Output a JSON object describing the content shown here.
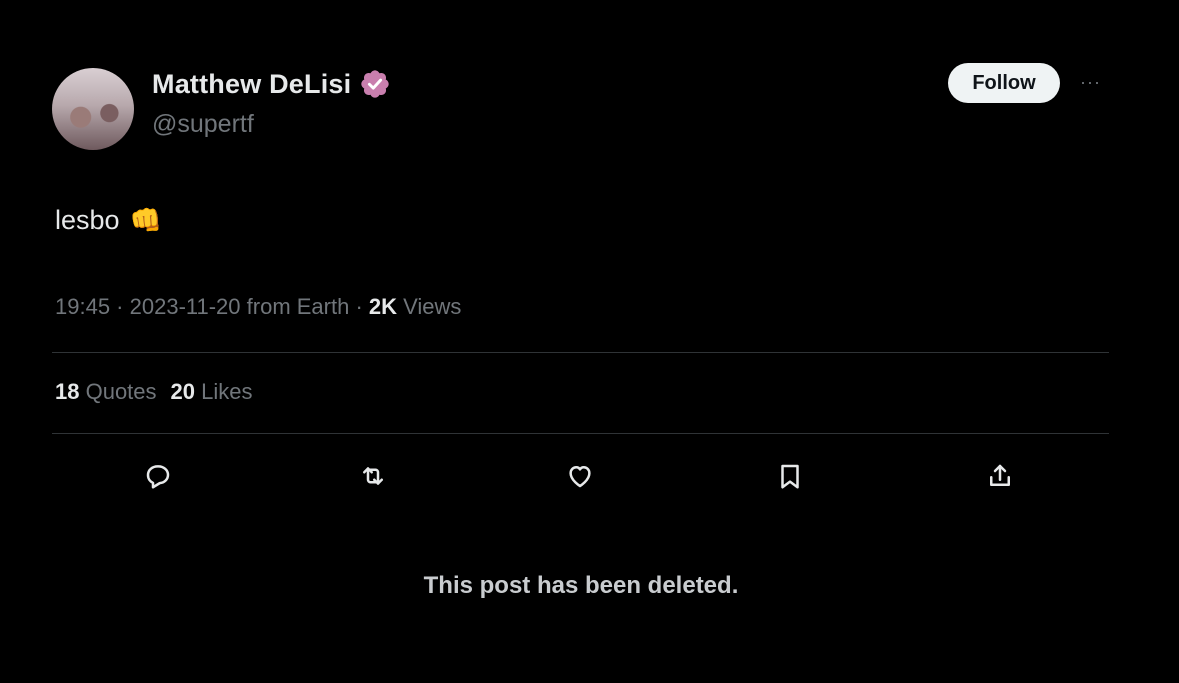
{
  "author": {
    "display_name": "Matthew DeLisi",
    "handle": "@supertf",
    "verified_icon": "verified-badge-icon",
    "verified_color": "#c97fae"
  },
  "header": {
    "follow_label": "Follow",
    "more_label": "···"
  },
  "post": {
    "text": "lesbo",
    "emoji": "👊"
  },
  "meta": {
    "time": "19:45",
    "sep1": " · ",
    "date": "2023-11-20",
    "source": " from Earth",
    "sep2": " · ",
    "views_count": "2K",
    "views_label": " Views"
  },
  "stats": {
    "quotes_count": "18",
    "quotes_label": " Quotes",
    "likes_count": "20",
    "likes_label": " Likes"
  },
  "actions": [
    {
      "name": "reply",
      "icon": "reply-icon"
    },
    {
      "name": "repost",
      "icon": "repost-icon"
    },
    {
      "name": "like",
      "icon": "heart-icon"
    },
    {
      "name": "bookmark",
      "icon": "bookmark-icon"
    },
    {
      "name": "share",
      "icon": "share-icon"
    }
  ],
  "notice": "This post has been deleted.",
  "colors": {
    "background": "#000000",
    "text_primary": "#e7e9ea",
    "text_secondary": "#71767b",
    "divider": "#2f3336"
  }
}
